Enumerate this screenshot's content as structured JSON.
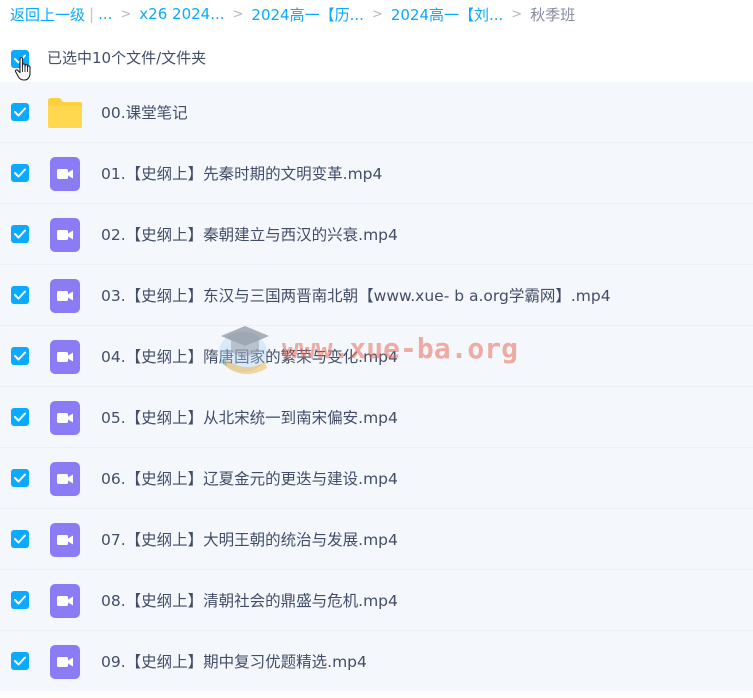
{
  "breadcrumb": {
    "back": "返回上一级",
    "ellipsis": "...",
    "items": [
      "x26 2024...",
      "2024高一【历...",
      "2024高一【刘..."
    ],
    "current": "秋季班"
  },
  "selection": {
    "text": "已选中10个文件/文件夹",
    "checked": true
  },
  "files": [
    {
      "name": "00.课堂笔记",
      "type": "folder",
      "checked": true
    },
    {
      "name": "01.【史纲上】先秦时期的文明变革.mp4",
      "type": "video",
      "checked": true
    },
    {
      "name": "02.【史纲上】秦朝建立与西汉的兴衰.mp4",
      "type": "video",
      "checked": true
    },
    {
      "name": "03.【史纲上】东汉与三国两晋南北朝【www.xue- b a.org学霸网】.mp4",
      "type": "video",
      "checked": true
    },
    {
      "name": "04.【史纲上】隋唐国家的繁荣与变化.mp4",
      "type": "video",
      "checked": true
    },
    {
      "name": "05.【史纲上】从北宋统一到南宋偏安.mp4",
      "type": "video",
      "checked": true
    },
    {
      "name": "06.【史纲上】辽夏金元的更迭与建设.mp4",
      "type": "video",
      "checked": true
    },
    {
      "name": "07.【史纲上】大明王朝的统治与发展.mp4",
      "type": "video",
      "checked": true
    },
    {
      "name": "08.【史纲上】清朝社会的鼎盛与危机.mp4",
      "type": "video",
      "checked": true
    },
    {
      "name": "09.【史纲上】期中复习优题精选.mp4",
      "type": "video",
      "checked": true
    }
  ],
  "watermark": {
    "text": "www.xue-ba.org"
  },
  "colors": {
    "accent": "#09aaff",
    "folder": "#ffcf3d",
    "video": "#8b7cf6",
    "row_bg": "#f4f7fc"
  },
  "icons": {
    "checkbox": "check-icon",
    "folder": "folder-icon",
    "video": "video-file-icon",
    "cursor": "hand-cursor-icon",
    "watermark": "graduation-cap-icon"
  }
}
